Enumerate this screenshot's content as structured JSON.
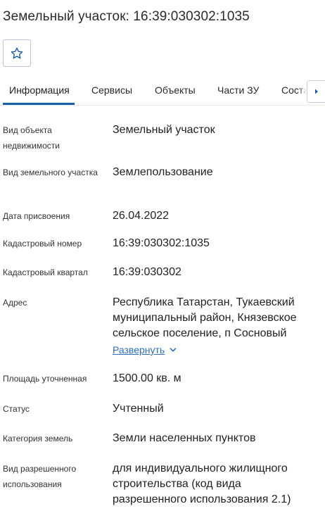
{
  "title": "Земельный участок: 16:39:030302:1035",
  "favorite": {
    "icon": "star-outline-icon"
  },
  "tabs": [
    {
      "label": "Информация",
      "active": true
    },
    {
      "label": "Сервисы"
    },
    {
      "label": "Объекты"
    },
    {
      "label": "Части ЗУ"
    },
    {
      "label": "Соста"
    }
  ],
  "tab_scroll_icon": "chevron-right-icon",
  "colors": {
    "accent": "#1a5fa8",
    "link": "#2f6fb5",
    "border": "#b7c4d6"
  },
  "fields": {
    "object_type": {
      "label": "Вид объекта недвижимости",
      "value": "Земельный участок"
    },
    "plot_type": {
      "label": "Вид земельного участка",
      "value": "Землепользование"
    },
    "assign_date": {
      "label": "Дата присвоения",
      "value": "26.04.2022"
    },
    "cadastral_number": {
      "label": "Кадастровый номер",
      "value": "16:39:030302:1035"
    },
    "cadastral_block": {
      "label": "Кадастровый квартал",
      "value": "16:39:030302"
    },
    "address": {
      "label": "Адрес",
      "value": "Республика Татарстан, Тукаевский муниципальный район, Князевское сельское поселение, п Сосновый",
      "expand_label": "Развернуть",
      "expand_icon": "chevron-down-icon"
    },
    "area": {
      "label": "Площадь уточненная",
      "value": "1500.00 кв. м"
    },
    "status": {
      "label": "Статус",
      "value": "Учтенный"
    },
    "land_category": {
      "label": "Категория земель",
      "value": "Земли населенных пунктов"
    },
    "permitted_use": {
      "label": "Вид разрешенного использования",
      "value": "для индивидуального жилищного строительства (код вида разрешенного использования 2.1)"
    }
  }
}
